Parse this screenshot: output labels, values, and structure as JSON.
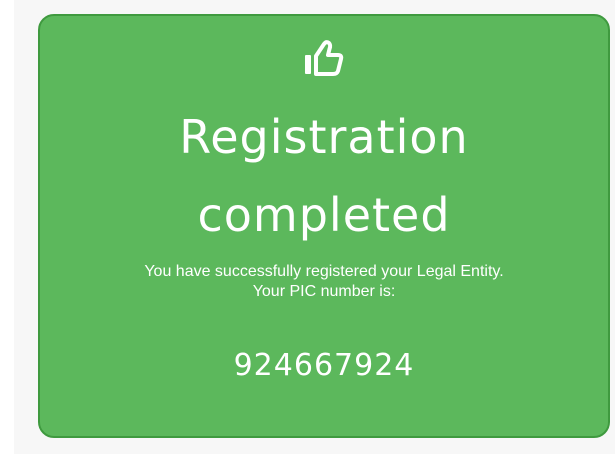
{
  "colors": {
    "card_background": "#5cb85c",
    "card_border": "#3f9a3f",
    "text": "#ffffff"
  },
  "card": {
    "icon": "thumbs-up-icon",
    "title_line1": "Registration",
    "title_line2": "completed",
    "message_line1": "You have successfully registered your Legal Entity.",
    "message_line2": "Your PIC number is:",
    "pic_number": "924667924"
  }
}
